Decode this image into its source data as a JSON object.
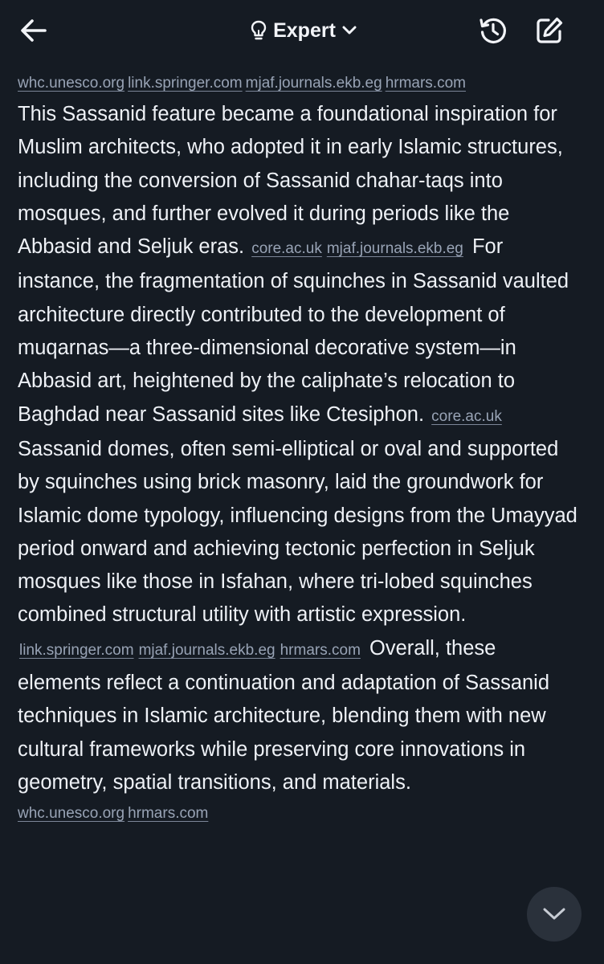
{
  "header": {
    "mode_label": "Expert",
    "icons": {
      "back": "arrow-left-icon",
      "mode": "lightbulb-icon",
      "mode_dropdown": "chevron-down-icon",
      "history": "history-icon",
      "new_chat": "edit-icon"
    }
  },
  "sources_top": [
    "whc.unesco.org",
    "link.springer.com",
    "mjaf.journals.ekb.eg",
    "hrmars.com"
  ],
  "paragraph": {
    "seg1": "This Sassanid feature became a foundational inspiration for Muslim architects, who adopted it in early Islamic structures, including the conversion of Sassanid chahar-taqs into mosques, and further evolved it during periods like the Abbasid and Seljuk eras.",
    "cites1": [
      "core.ac.uk",
      "mjaf.journals.ekb.eg"
    ],
    "seg2": "For instance, the fragmentation of squinches in Sassanid vaulted architecture directly contributed to the development of muqarnas—a three-dimensional decorative system—in Abbasid art, heightened by the caliphate’s relocation to Baghdad near Sassanid sites like Ctesiphon.",
    "cites2": [
      "core.ac.uk"
    ],
    "seg3": "Sassanid domes, often semi-elliptical or oval and supported by squinches using brick masonry, laid the groundwork for Islamic dome typology, influencing designs from the Umayyad period onward and achieving tectonic perfection in Seljuk mosques like those in Isfahan, where tri-lobed squinches combined structural utility with artistic expression.",
    "cites3": [
      "link.springer.com",
      "mjaf.journals.ekb.eg",
      "hrmars.com"
    ],
    "seg4": "Overall, these elements reflect a continuation and adaptation of Sassanid techniques in Islamic architecture, blending them with new cultural frameworks while preserving core innovations in geometry, spatial transitions, and materials."
  },
  "sources_bottom": [
    "whc.unesco.org",
    "hrmars.com"
  ],
  "scroll_button": {
    "icon": "chevron-down-icon"
  },
  "colors": {
    "background": "#151b23",
    "text": "#eef1f6",
    "link": "#98a3b5",
    "fab": "#2a313b"
  }
}
